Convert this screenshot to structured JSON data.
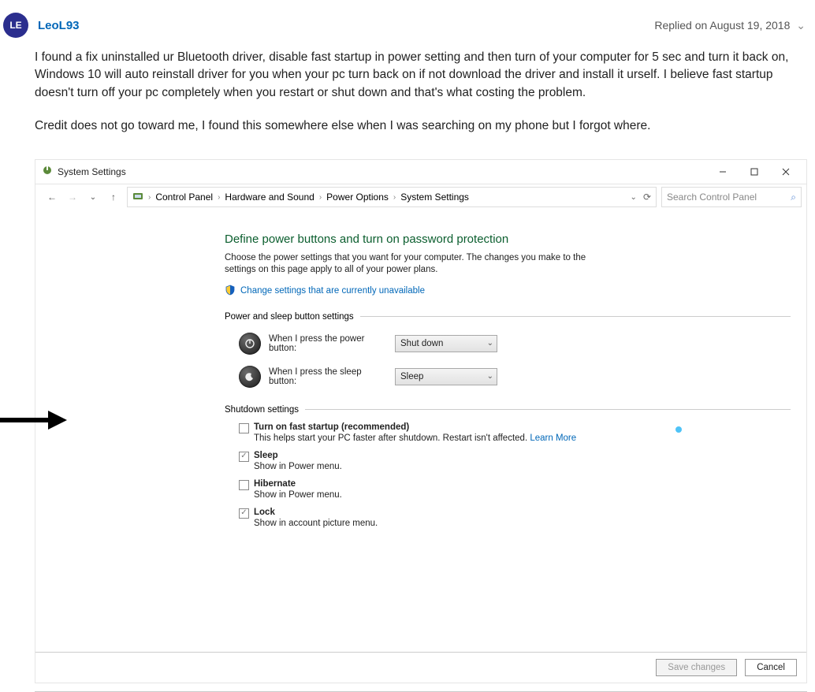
{
  "post": {
    "avatar_initials": "LE",
    "author": "LeoL93",
    "reply_meta": "Replied on August 19, 2018",
    "paragraph1": "I found a fix uninstalled ur Bluetooth driver, disable fast startup in power setting and then turn of your computer for 5 sec and turn it back on, Windows 10 will auto reinstall driver for you when your pc turn back on if not download the driver and install it urself. I believe fast startup doesn't turn off your pc completely when you restart or shut down and that's what costing the problem.",
    "paragraph2": "Credit does not go toward me, I found this somewhere else when I was searching on my phone but I forgot where."
  },
  "window": {
    "title": "System Settings",
    "breadcrumbs": [
      "Control Panel",
      "Hardware and Sound",
      "Power Options",
      "System Settings"
    ],
    "search_placeholder": "Search Control Panel"
  },
  "page": {
    "heading": "Define power buttons and turn on password protection",
    "subheading": "Choose the power settings that you want for your computer. The changes you make to the settings on this page apply to all of your power plans.",
    "change_link": "Change settings that are currently unavailable",
    "section1": "Power and sleep button settings",
    "power_label": "When I press the power button:",
    "power_value": "Shut down",
    "sleep_label": "When I press the sleep button:",
    "sleep_value": "Sleep",
    "section2": "Shutdown settings",
    "fast_label": "Turn on fast startup (recommended)",
    "fast_desc": "This helps start your PC faster after shutdown. Restart isn't affected. ",
    "learn_more": "Learn More",
    "sleep_ck": "Sleep",
    "sleep_ck_desc": "Show in Power menu.",
    "hib_ck": "Hibernate",
    "hib_ck_desc": "Show in Power menu.",
    "lock_ck": "Lock",
    "lock_ck_desc": "Show in account picture menu."
  },
  "footer": {
    "save": "Save changes",
    "cancel": "Cancel"
  }
}
